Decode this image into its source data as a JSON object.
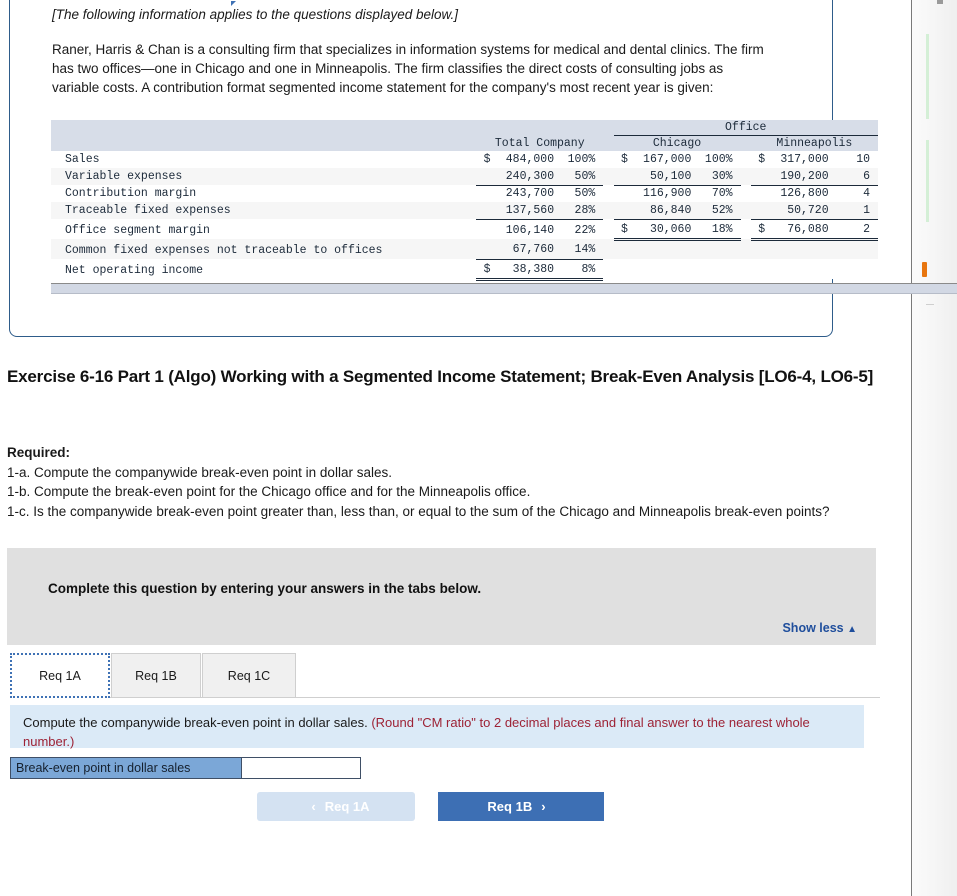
{
  "info_panel": {
    "note": "[The following information applies to the questions displayed below.]",
    "body": "Raner, Harris & Chan is a consulting firm that specializes in information systems for medical and dental clinics. The firm has two offices—one in Chicago and one in Minneapolis. The firm classifies the direct costs of consulting jobs as variable costs. A contribution format segmented income statement for the company's most recent year is given:"
  },
  "statement": {
    "group_header": "Office",
    "columns": [
      "Total Company",
      "Chicago",
      "Minneapolis"
    ],
    "rows": [
      {
        "label": "Sales",
        "total_cur": "$",
        "total_num": "484,000",
        "total_pct": "100%",
        "chi_cur": "$",
        "chi_num": "167,000",
        "chi_pct": "100%",
        "min_cur": "$",
        "min_num": "317,000",
        "min_pct": "10"
      },
      {
        "label": "Variable expenses",
        "total_cur": "",
        "total_num": "240,300",
        "total_pct": "50%",
        "chi_cur": "",
        "chi_num": "50,100",
        "chi_pct": "30%",
        "min_cur": "",
        "min_num": "190,200",
        "min_pct": "6"
      },
      {
        "label": "Contribution margin",
        "total_cur": "",
        "total_num": "243,700",
        "total_pct": "50%",
        "chi_cur": "",
        "chi_num": "116,900",
        "chi_pct": "70%",
        "min_cur": "",
        "min_num": "126,800",
        "min_pct": "4"
      },
      {
        "label": "Traceable fixed expenses",
        "total_cur": "",
        "total_num": "137,560",
        "total_pct": "28%",
        "chi_cur": "",
        "chi_num": "86,840",
        "chi_pct": "52%",
        "min_cur": "",
        "min_num": "50,720",
        "min_pct": "1"
      },
      {
        "label": "Office segment margin",
        "total_cur": "",
        "total_num": "106,140",
        "total_pct": "22%",
        "chi_cur": "$",
        "chi_num": "30,060",
        "chi_pct": "18%",
        "min_cur": "$",
        "min_num": "76,080",
        "min_pct": "2"
      },
      {
        "label": "Common fixed expenses not traceable to offices",
        "total_cur": "",
        "total_num": "67,760",
        "total_pct": "14%",
        "chi_cur": "",
        "chi_num": "",
        "chi_pct": "",
        "min_cur": "",
        "min_num": "",
        "min_pct": ""
      },
      {
        "label": "Net operating income",
        "total_cur": "$",
        "total_num": "38,380",
        "total_pct": "8%",
        "chi_cur": "",
        "chi_num": "",
        "chi_pct": "",
        "min_cur": "",
        "min_num": "",
        "min_pct": ""
      }
    ]
  },
  "exercise": {
    "title": "Exercise 6-16 Part 1 (Algo) Working with a Segmented Income Statement; Break-Even Analysis [LO6-4, LO6-5]"
  },
  "required": {
    "heading": "Required:",
    "items": [
      "1-a. Compute the companywide break-even point in dollar sales.",
      "1-b. Compute the break-even point for the Chicago office and for the Minneapolis office.",
      "1-c. Is the companywide break-even point greater than, less than, or equal to the sum of the Chicago and Minneapolis break-even points?"
    ]
  },
  "instructions": {
    "text": "Complete this question by entering your answers in the tabs below.",
    "show_less": "Show less",
    "caret": "▲"
  },
  "tabs": [
    {
      "label": "Req 1A",
      "active": true
    },
    {
      "label": "Req 1B",
      "active": false
    },
    {
      "label": "Req 1C",
      "active": false
    }
  ],
  "question": {
    "prompt": "Compute the companywide break-even point in dollar sales.",
    "hint": "(Round \"CM ratio\" to 2 decimal places and final answer to the nearest whole number.)"
  },
  "answer": {
    "label": "Break-even point in dollar sales",
    "value": "",
    "placeholder": ""
  },
  "nav": {
    "prev_label": "Req 1A",
    "prev_chevron": "‹",
    "next_label": "Req 1B",
    "next_chevron": "›"
  },
  "colors": {
    "panel_border": "#2e5c8a",
    "table_header": "#d7dde8",
    "gray_panel": "#e0e0e0",
    "question_strip": "#dbeaf7",
    "link_blue": "#1f4e9c",
    "answer_label_blue": "#7ba7d7",
    "next_button_blue": "#3d6fb4",
    "prev_button_blue": "#d4e2f2",
    "hint_red": "#9d2235"
  }
}
